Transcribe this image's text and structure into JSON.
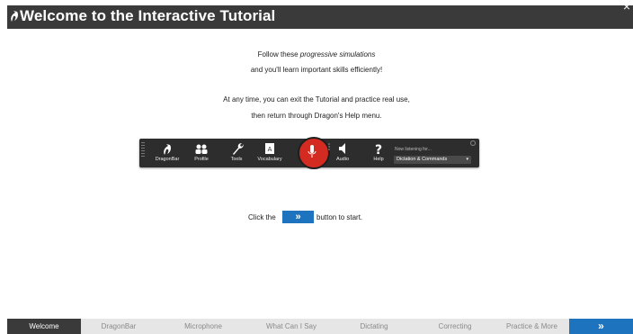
{
  "window": {
    "title": "Welcome to the Interactive Tutorial",
    "close_glyph": "×"
  },
  "intro": {
    "line1_pre": "Follow these ",
    "line1_em": "progressive simulations",
    "line2": "and you'll learn important skills efficiently!",
    "line3": "At any time, you can exit the Tutorial and practice real use,",
    "line4": "then return through Dragon's Help menu."
  },
  "dragonbar": {
    "items": [
      {
        "label": "DragonBar",
        "icon": "dragon-logo-icon"
      },
      {
        "label": "Profile",
        "icon": "profile-icon"
      },
      {
        "label": "Tools",
        "icon": "wrench-icon"
      },
      {
        "label": "Vocabulary",
        "icon": "vocabulary-icon"
      },
      {
        "label": "Audio",
        "icon": "speaker-icon"
      },
      {
        "label": "Help",
        "icon": "question-icon"
      }
    ],
    "listening_label": "Now listening for...",
    "mode_value": "Dictation & Commands",
    "mic_color": "#d32b22"
  },
  "start_prompt": {
    "pre": "Click the",
    "button": "»",
    "post": "button to start."
  },
  "nav": {
    "tabs": [
      "Welcome",
      "DragonBar",
      "Microphone",
      "What Can I Say",
      "Dictating",
      "Correcting",
      "Practice & More"
    ],
    "active_index": 0,
    "next_glyph": "»"
  },
  "colors": {
    "accent": "#1e73be",
    "titlebar": "#3a3a3a"
  }
}
